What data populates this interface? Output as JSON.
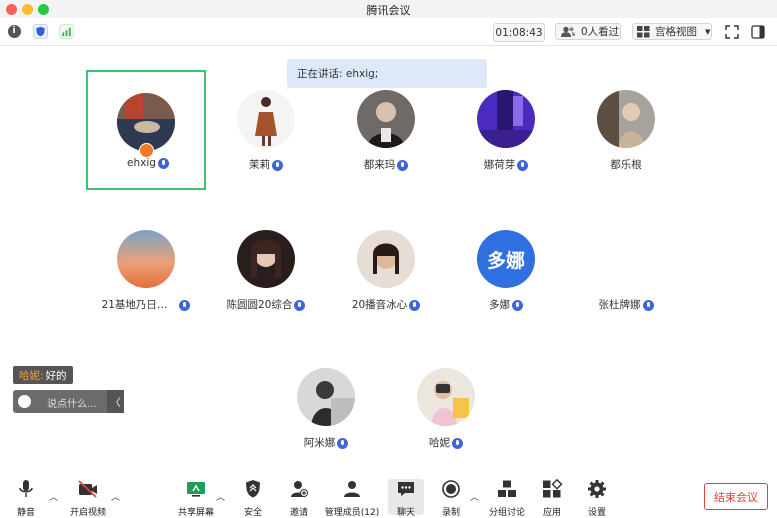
{
  "window": {
    "title": "腾讯会议"
  },
  "topbar": {
    "timer": "01:08:43",
    "viewers": "0人看过",
    "view_mode": "宫格视图"
  },
  "speaking": {
    "text": "正在讲话: ehxig;"
  },
  "participants": [
    {
      "name": "ehxig",
      "host": true,
      "speaking": true
    },
    {
      "name": "茉莉"
    },
    {
      "name": "都来玛"
    },
    {
      "name": "娜荷芽"
    },
    {
      "name": "都乐根"
    },
    {
      "name": "21基地乃日…"
    },
    {
      "name": "陈圆圆20综合"
    },
    {
      "name": "20播音冰心"
    },
    {
      "name": "多娜",
      "initials": "多娜"
    },
    {
      "name": "张杜牌娜"
    },
    {
      "name": "阿米娜"
    },
    {
      "name": "哈妮"
    }
  ],
  "chat": {
    "sender": "哈妮:",
    "message": "好的",
    "input_placeholder": "说点什么..."
  },
  "toolbar": {
    "mute": "静音",
    "video": "开启视频",
    "share": "共享屏幕",
    "security": "安全",
    "invite": "邀请",
    "members": "管理成员(12)",
    "chat": "聊天",
    "record": "录制",
    "breakout": "分组讨论",
    "apps": "应用",
    "settings": "设置",
    "end": "结束会议"
  },
  "colors": {
    "active_border": "#3cc46b",
    "mic": "#3f66d8",
    "end_meeting": "#e0433b",
    "speaking_bg": "#dde9f9"
  }
}
